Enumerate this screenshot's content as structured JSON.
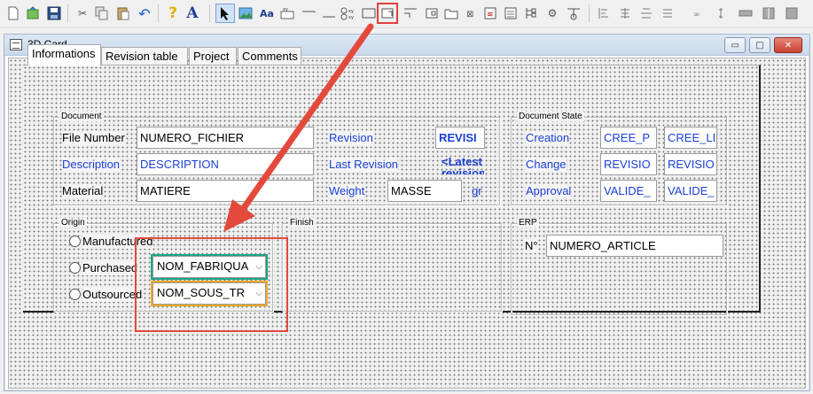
{
  "window": {
    "title": "3D Card"
  },
  "window_controls": {
    "minimize": "▭",
    "maximize": "□",
    "close": "✕"
  },
  "toolbar": {
    "icons": [
      "new-icon",
      "open-icon",
      "save-icon",
      "cut-icon",
      "copy-icon",
      "paste-icon",
      "undo-icon",
      "help-icon",
      "font-icon",
      "pointer-icon",
      "image-icon",
      "text-tool-icon",
      "field-tool-icon",
      "line-tool-icon",
      "box-tool-icon",
      "radio-tool-icon",
      "group-tool-icon",
      "tab-tool-icon",
      "frame-tool-icon",
      "button-tool-icon",
      "checkbox-tool-icon",
      "table-tool-icon",
      "tree-tool-icon",
      "gear-icon",
      "preview-icon",
      "align-left-icon",
      "align-center-icon",
      "align-right-icon",
      "link-icon",
      "split-icon",
      "pane-left-icon",
      "pane-right-icon",
      "pane-full-icon"
    ],
    "labels": {
      "font": "A",
      "text_tool": "Aa",
      "help": "?"
    }
  },
  "tabs": [
    "Informations",
    "Revision table",
    "Project",
    "Comments"
  ],
  "groups": {
    "document": "Document",
    "document_state": "Document State",
    "origin": "Origin",
    "finish": "Finish",
    "erp": "ERP"
  },
  "document": {
    "file_number_label": "File Number",
    "file_number_value": "NUMERO_FICHIER",
    "description_label": "Description",
    "description_value": "DESCRIPTION",
    "material_label": "Material",
    "material_value": "MATIERE",
    "revision_label": "Revision",
    "revision_value": "REVISI",
    "last_revision_label": "Last Revision",
    "last_revision_value": "<Latest revision",
    "weight_label": "Weight",
    "weight_value": "MASSE",
    "weight_unit": "gr"
  },
  "document_state": {
    "creation_label": "Creation",
    "change_label": "Change",
    "approval_label": "Approval",
    "creation_values": [
      "CREE_P",
      "CREE_LI"
    ],
    "change_values": [
      "REVISIO",
      "REVISIO"
    ],
    "approval_values": [
      "VALIDE_",
      "VALIDE_"
    ]
  },
  "origin": {
    "manufactured_label": "Manufactured",
    "purchased_label": "Purchased",
    "outsourced_label": "Outsourced",
    "purchased_combo": "NOM_FABRIQUA",
    "outsourced_combo": "NOM_SOUS_TR"
  },
  "erp": {
    "number_label": "N°",
    "number_value": "NUMERO_ARTICLE"
  },
  "colors": {
    "annotation_red": "#e34a3c",
    "annotation_teal": "#1ea386",
    "annotation_orange": "#f0a92a",
    "label_blue": "#1a3fd6"
  }
}
